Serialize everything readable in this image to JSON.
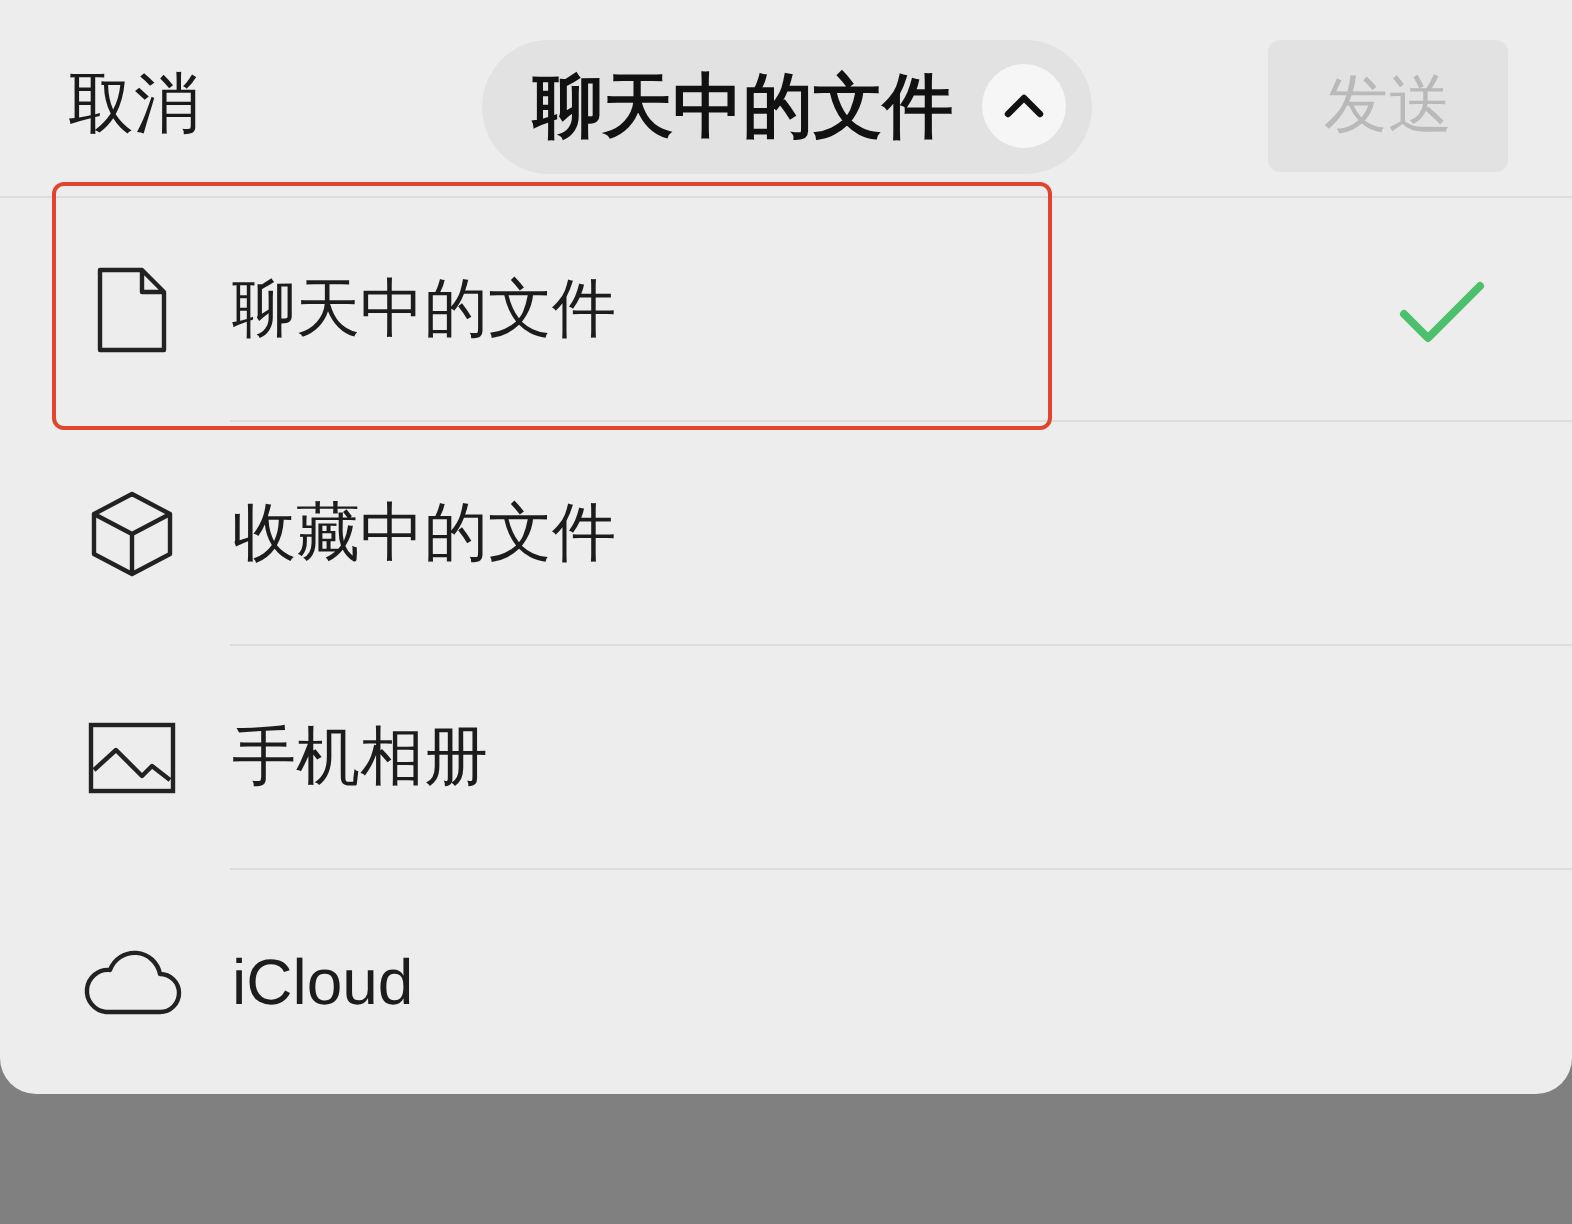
{
  "header": {
    "cancel": "取消",
    "title": "聊天中的文件",
    "expanded": true,
    "send": {
      "label": "发送",
      "disabled": true
    }
  },
  "sources": [
    {
      "kind": "file",
      "label": "聊天中的文件",
      "selected": true,
      "highlighted": true
    },
    {
      "kind": "cube",
      "label": "收藏中的文件",
      "selected": false,
      "highlighted": false
    },
    {
      "kind": "image",
      "label": "手机相册",
      "selected": false,
      "highlighted": false
    },
    {
      "kind": "cloud",
      "label": "iCloud",
      "selected": false,
      "highlighted": false
    }
  ]
}
